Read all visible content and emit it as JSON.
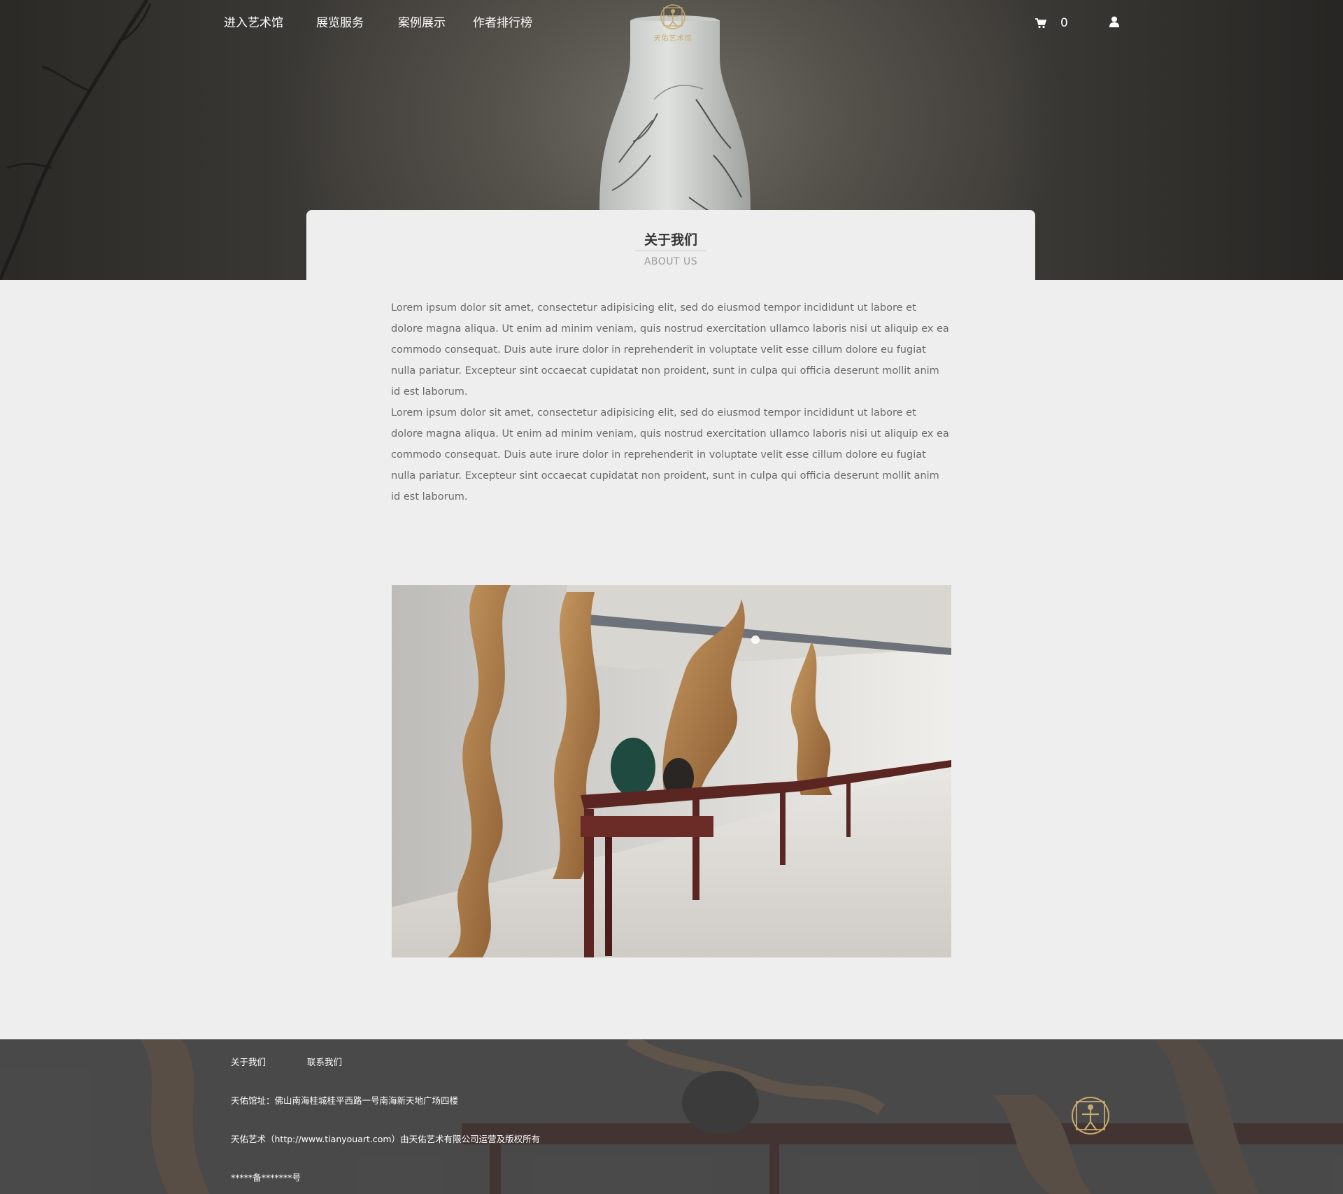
{
  "header": {
    "nav": [
      {
        "label": "进入艺术馆"
      },
      {
        "label": "展览服务"
      },
      {
        "label": "案例展示"
      },
      {
        "label": "作者排行榜"
      }
    ],
    "logo_text": "天佑艺术馆",
    "cart_count": "0",
    "icons": {
      "cart": "cart-icon",
      "user": "user-icon"
    }
  },
  "about": {
    "title": "关于我们",
    "subtitle": "ABOUT US",
    "paragraphs": [
      "Lorem ipsum dolor sit amet, consectetur adipisicing elit, sed do eiusmod tempor incididunt ut labore et dolore magna aliqua. Ut enim ad minim veniam, quis nostrud exercitation ullamco laboris nisi ut aliquip ex ea commodo consequat. Duis aute irure dolor in reprehenderit in voluptate velit esse cillum dolore eu fugiat nulla pariatur. Excepteur sint occaecat cupidatat non proident, sunt in culpa qui officia deserunt mollit anim id est laborum.",
      "Lorem ipsum dolor sit amet, consectetur adipisicing elit, sed do eiusmod tempor incididunt ut labore et dolore magna aliqua. Ut enim ad minim veniam, quis nostrud exercitation ullamco laboris nisi ut aliquip ex ea commodo consequat. Duis aute irure dolor in reprehenderit in voluptate velit esse cillum dolore eu fugiat nulla pariatur. Excepteur sint occaecat cupidatat non proident, sunt in culpa qui officia deserunt mollit anim id est laborum."
    ]
  },
  "footer": {
    "links": [
      {
        "label": "关于我们"
      },
      {
        "label": "联系我们"
      }
    ],
    "address": "天佑馆址：佛山南海桂城桂平西路一号南海新天地广场四楼",
    "copyright": "天佑艺术（http://www.tianyouart.com）由天佑艺术有限公司运营及版权所有",
    "icp": "*****备*******号"
  },
  "colors": {
    "page_bg": "#eeeeee",
    "hero_dark": "#3c3a36",
    "gold": "#c6aa6c",
    "text_body": "#6a6a6a",
    "footer_bg": "#4a4a4a"
  }
}
